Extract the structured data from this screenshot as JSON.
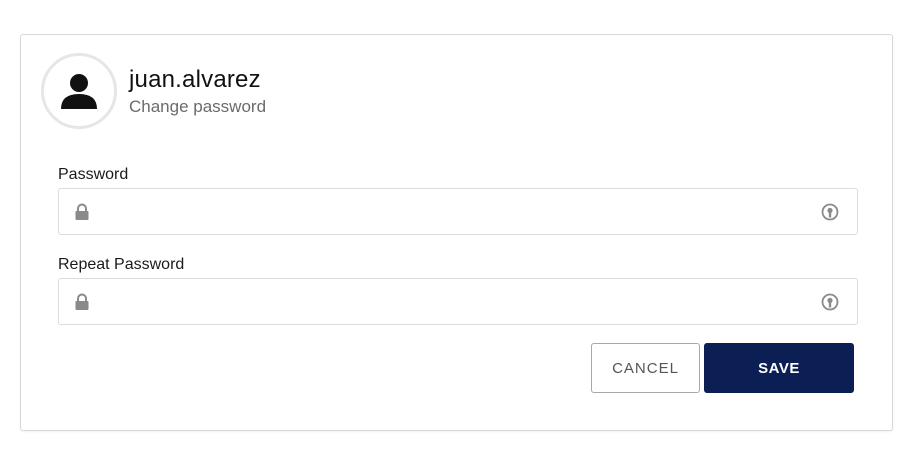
{
  "profile": {
    "username": "juan.alvarez",
    "subtitle": "Change password",
    "avatar_icon": "user-silhouette-icon"
  },
  "form": {
    "password": {
      "label": "Password",
      "value": "",
      "placeholder": "",
      "leading_icon": "lock-icon",
      "trailing_icon": "eye-reveal-icon"
    },
    "repeat_password": {
      "label": "Repeat Password",
      "value": "",
      "placeholder": "",
      "leading_icon": "lock-icon",
      "trailing_icon": "eye-reveal-icon"
    }
  },
  "actions": {
    "cancel_label": "CANCEL",
    "save_label": "SAVE"
  },
  "colors": {
    "primary": "#0b1f55",
    "icon_gray": "#8a8a8a",
    "border": "#dcdcdc"
  }
}
